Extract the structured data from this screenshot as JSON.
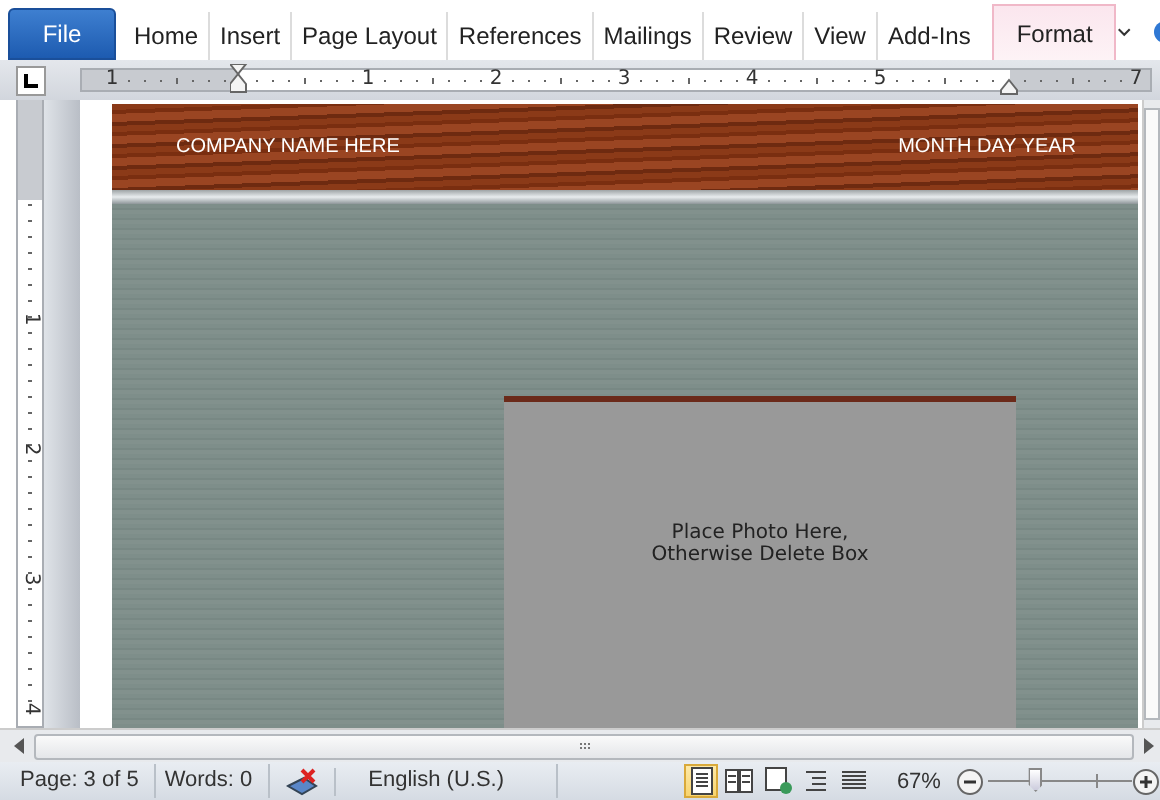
{
  "ribbon": {
    "tabs": [
      {
        "label": "File",
        "kind": "file",
        "selected": false
      },
      {
        "label": "Home",
        "kind": "tab",
        "selected": false
      },
      {
        "label": "Insert",
        "kind": "tab",
        "selected": false
      },
      {
        "label": "Page Layout",
        "kind": "tab",
        "selected": false
      },
      {
        "label": "References",
        "kind": "tab",
        "selected": false
      },
      {
        "label": "Mailings",
        "kind": "tab",
        "selected": false
      },
      {
        "label": "Review",
        "kind": "tab",
        "selected": false
      },
      {
        "label": "View",
        "kind": "tab",
        "selected": false
      },
      {
        "label": "Add-Ins",
        "kind": "tab",
        "selected": false
      },
      {
        "label": "Format",
        "kind": "contextual",
        "selected": false
      }
    ]
  },
  "ruler": {
    "horizontal": [
      "1",
      "1",
      "2",
      "3",
      "4",
      "5",
      "7"
    ],
    "vertical": [
      "1",
      "2",
      "3",
      "4"
    ]
  },
  "document": {
    "company": "COMPANY NAME HERE",
    "date": "MONTH DAY YEAR",
    "photo_placeholder": [
      "Place Photo Here,",
      "Otherwise Delete Box"
    ]
  },
  "status_bar": {
    "page": "Page: 3 of 5",
    "words": "Words: 0",
    "language": "English (U.S.)",
    "views": [
      {
        "kind": "print",
        "selected": true
      },
      {
        "kind": "reading",
        "selected": false
      },
      {
        "kind": "web",
        "selected": false
      },
      {
        "kind": "outline",
        "selected": false
      },
      {
        "kind": "draft",
        "selected": false
      }
    ],
    "zoom": "67%",
    "zoom_slider": {
      "level": 0.32
    }
  }
}
